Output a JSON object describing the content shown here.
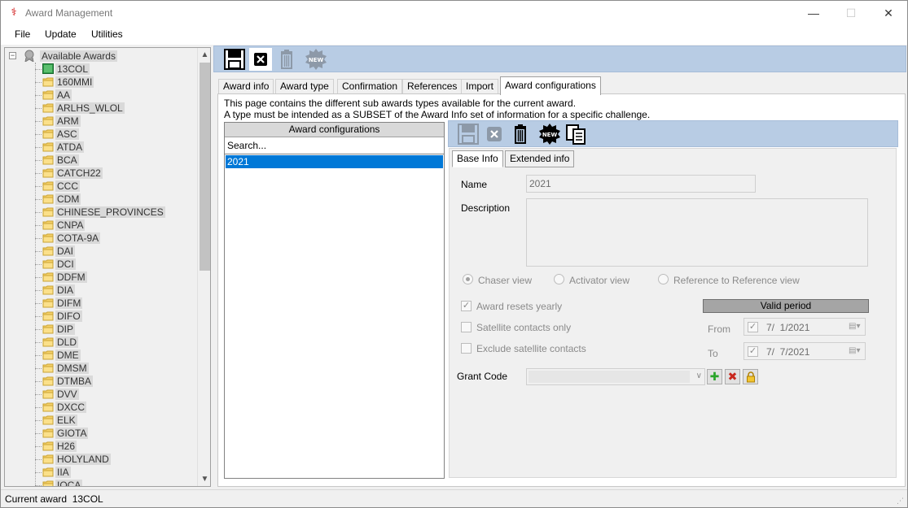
{
  "window": {
    "title": "Award Management",
    "minimize": "—",
    "maximize": "☐",
    "close": "✕"
  },
  "menu": [
    "File",
    "Update",
    "Utilities"
  ],
  "tree": {
    "root_label": "Available Awards",
    "items": [
      "13COL",
      "160MMI",
      "AA",
      "ARLHS_WLOL",
      "ARM",
      "ASC",
      "ATDA",
      "BCA",
      "CATCH22",
      "CCC",
      "CDM",
      "CHINESE_PROVINCES",
      "CNPA",
      "COTA-9A",
      "DAI",
      "DCI",
      "DDFM",
      "DIA",
      "DIFM",
      "DIFO",
      "DIP",
      "DLD",
      "DME",
      "DMSM",
      "DTMBA",
      "DVV",
      "DXCC",
      "ELK",
      "GIOTA",
      "H26",
      "HOLYLAND",
      "IIA",
      "IOCA"
    ]
  },
  "main_toolbar_icons": [
    "save-icon",
    "close-icon",
    "trash-icon",
    "new-icon"
  ],
  "tabs": [
    "Award info",
    "Award type",
    "Confirmation",
    "References",
    "Import",
    "Award configurations"
  ],
  "description_lines": [
    "This page contains the different sub awards types available for the current award.",
    "A type must be intended as a SUBSET of the Award Info set of information for a specific challenge."
  ],
  "config_list": {
    "header": "Award configurations",
    "search_placeholder": "Search...",
    "rows": [
      "2021"
    ]
  },
  "sub_tabs": [
    "Base Info",
    "Extended info"
  ],
  "base_info": {
    "name_label": "Name",
    "name_value": "2021",
    "description_label": "Description",
    "views": [
      "Chaser view",
      "Activator view",
      "Reference to Reference view"
    ],
    "options": [
      "Award resets yearly",
      "Satellite contacts only",
      "Exclude satellite contacts"
    ],
    "valid_period": {
      "header": "Valid period",
      "from_label": "From",
      "from_value": "7/  1/2021",
      "to_label": "To",
      "to_value": "7/  7/2021"
    },
    "grant_code_label": "Grant Code"
  },
  "status": {
    "label": "Current award",
    "value": "13COL"
  },
  "colors": {
    "toolbar_bg": "#b8cce4",
    "selection": "#0078d7",
    "valid_header_bg": "#a5a5a5"
  }
}
